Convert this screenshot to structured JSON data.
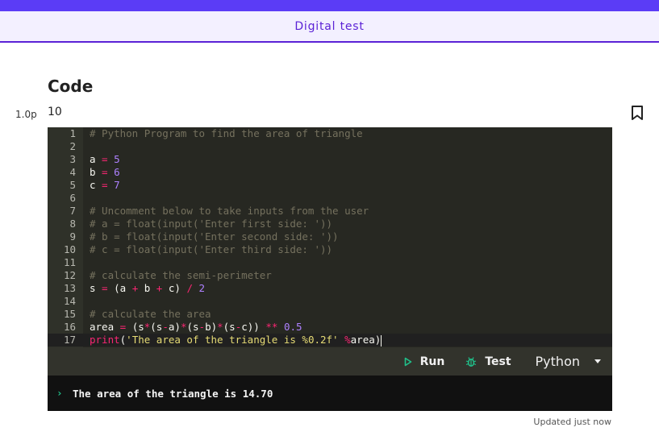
{
  "header": {
    "title": "Digital test"
  },
  "question": {
    "section_title": "Code",
    "points": "1.0p",
    "number": "10"
  },
  "icons": {
    "bookmark": "bookmark-icon",
    "run": "play-icon",
    "test": "bug-icon",
    "dropdown": "chevron-down-icon"
  },
  "editor": {
    "lines": [
      [
        {
          "t": "# Python Program to find the area of triangle",
          "c": "comment"
        }
      ],
      [],
      [
        {
          "t": "a",
          "c": ""
        },
        {
          "t": " = ",
          "c": "op"
        },
        {
          "t": "5",
          "c": "num"
        }
      ],
      [
        {
          "t": "b",
          "c": ""
        },
        {
          "t": " = ",
          "c": "op"
        },
        {
          "t": "6",
          "c": "num"
        }
      ],
      [
        {
          "t": "c",
          "c": ""
        },
        {
          "t": " = ",
          "c": "op"
        },
        {
          "t": "7",
          "c": "num"
        }
      ],
      [],
      [
        {
          "t": "# Uncomment below to take inputs from the user",
          "c": "comment"
        }
      ],
      [
        {
          "t": "# a = float(input('Enter first side: '))",
          "c": "comment"
        }
      ],
      [
        {
          "t": "# b = float(input('Enter second side: '))",
          "c": "comment"
        }
      ],
      [
        {
          "t": "# c = float(input('Enter third side: '))",
          "c": "comment"
        }
      ],
      [],
      [
        {
          "t": "# calculate the semi-perimeter",
          "c": "comment"
        }
      ],
      [
        {
          "t": "s",
          "c": ""
        },
        {
          "t": " = ",
          "c": "op"
        },
        {
          "t": "(a ",
          "c": ""
        },
        {
          "t": "+",
          "c": "op"
        },
        {
          "t": " b ",
          "c": ""
        },
        {
          "t": "+",
          "c": "op"
        },
        {
          "t": " c) ",
          "c": ""
        },
        {
          "t": "/",
          "c": "op"
        },
        {
          "t": " ",
          "c": ""
        },
        {
          "t": "2",
          "c": "num"
        }
      ],
      [],
      [
        {
          "t": "# calculate the area",
          "c": "comment"
        }
      ],
      [
        {
          "t": "area",
          "c": ""
        },
        {
          "t": " = ",
          "c": "op"
        },
        {
          "t": "(s",
          "c": ""
        },
        {
          "t": "*",
          "c": "op"
        },
        {
          "t": "(s",
          "c": ""
        },
        {
          "t": "-",
          "c": "op"
        },
        {
          "t": "a)",
          "c": ""
        },
        {
          "t": "*",
          "c": "op"
        },
        {
          "t": "(s",
          "c": ""
        },
        {
          "t": "-",
          "c": "op"
        },
        {
          "t": "b)",
          "c": ""
        },
        {
          "t": "*",
          "c": "op"
        },
        {
          "t": "(s",
          "c": ""
        },
        {
          "t": "-",
          "c": "op"
        },
        {
          "t": "c)) ",
          "c": ""
        },
        {
          "t": "**",
          "c": "op"
        },
        {
          "t": " ",
          "c": ""
        },
        {
          "t": "0.5",
          "c": "num"
        }
      ],
      [
        {
          "t": "print",
          "c": "fn"
        },
        {
          "t": "(",
          "c": ""
        },
        {
          "t": "'The area of the triangle is %0.2f'",
          "c": "str"
        },
        {
          "t": " ",
          "c": ""
        },
        {
          "t": "%",
          "c": "op"
        },
        {
          "t": "area)",
          "c": ""
        }
      ]
    ],
    "active_line": 17
  },
  "toolbar": {
    "run_label": "Run",
    "test_label": "Test",
    "language": "Python"
  },
  "console": {
    "prompt": "›",
    "output": "The area of the triangle is 14.70"
  },
  "status": {
    "updated": "Updated just now"
  },
  "colors": {
    "accent": "#5b3cf6",
    "title": "#5b22d6",
    "editor_bg": "#272822",
    "run_icon": "#20c08a"
  }
}
